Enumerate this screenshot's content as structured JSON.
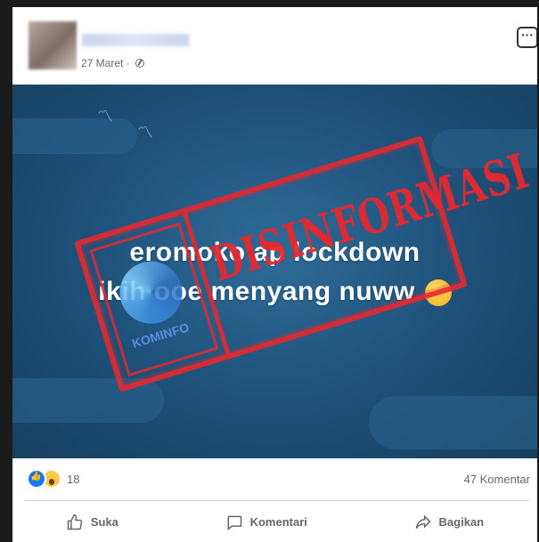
{
  "post": {
    "date": "27 Maret ·",
    "meme_lines": [
      "eromoko ap lockdown",
      "ikih  ooe menyang nuww"
    ],
    "stamp_label": "DISINFORMASI",
    "logo_label": "KOMINFO"
  },
  "reactions": {
    "count": "18",
    "comments": "47 Komentar"
  },
  "actions": {
    "like": "Suka",
    "comment": "Komentari",
    "share": "Bagikan"
  },
  "colors": {
    "stamp": "#e6282d",
    "image_bg": "#1d4f78",
    "like_blue": "#1877f2"
  }
}
